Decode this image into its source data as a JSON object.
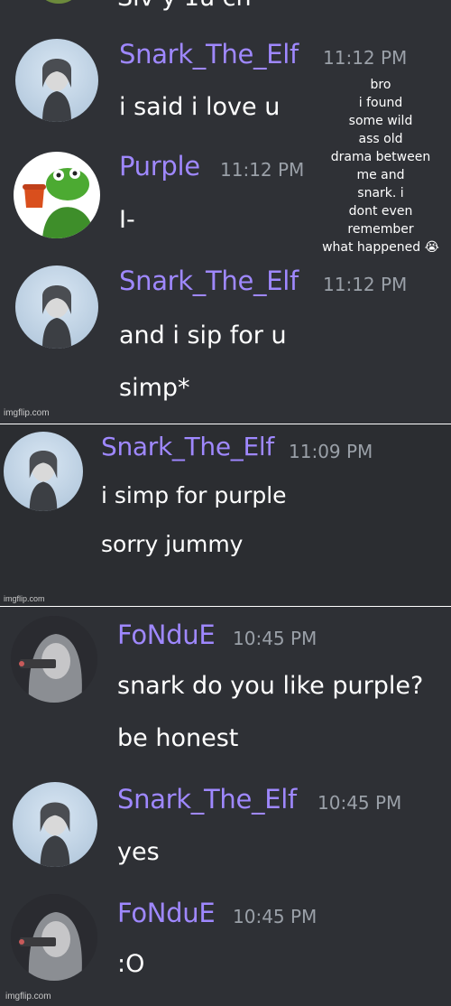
{
  "top_cut_text": "Siv y 1u ch",
  "overlay_caption": [
    "bro",
    "i found",
    "some wild",
    "ass old",
    "drama between",
    "me and",
    "snark. i",
    "dont even",
    "remember",
    "what happened 😭"
  ],
  "watermarks": [
    "imgflip.com",
    "imgflip.com",
    "imgflip.com"
  ],
  "messages": [
    {
      "author": "Snark_The_Elf",
      "time": "11:12 PM",
      "lines": [
        "i said i love u"
      ],
      "avatar": "statue"
    },
    {
      "author": "Purple",
      "time": "11:12 PM",
      "lines": [
        "I-"
      ],
      "avatar": "kermit"
    },
    {
      "author": "Snark_The_Elf",
      "time": "11:12 PM",
      "lines": [
        "and i sip for u",
        "simp*"
      ],
      "avatar": "statue"
    },
    {
      "author": "Snark_The_Elf",
      "time": "11:09 PM",
      "lines": [
        "i simp for purple",
        "sorry jummy"
      ],
      "avatar": "statue"
    },
    {
      "author": "FoNduE",
      "time": "10:45 PM",
      "lines": [
        "snark do you like purple?",
        "be honest"
      ],
      "avatar": "fondue"
    },
    {
      "author": "Snark_The_Elf",
      "time": "10:45 PM",
      "lines": [
        "yes"
      ],
      "avatar": "statue"
    },
    {
      "author": "FoNduE",
      "time": "10:45 PM",
      "lines": [
        ":O"
      ],
      "avatar": "fondue"
    }
  ],
  "colors": {
    "username": "#9f88ff",
    "timestamp": "#9aa0a8",
    "text": "#ffffff",
    "background": "#2f3136"
  }
}
